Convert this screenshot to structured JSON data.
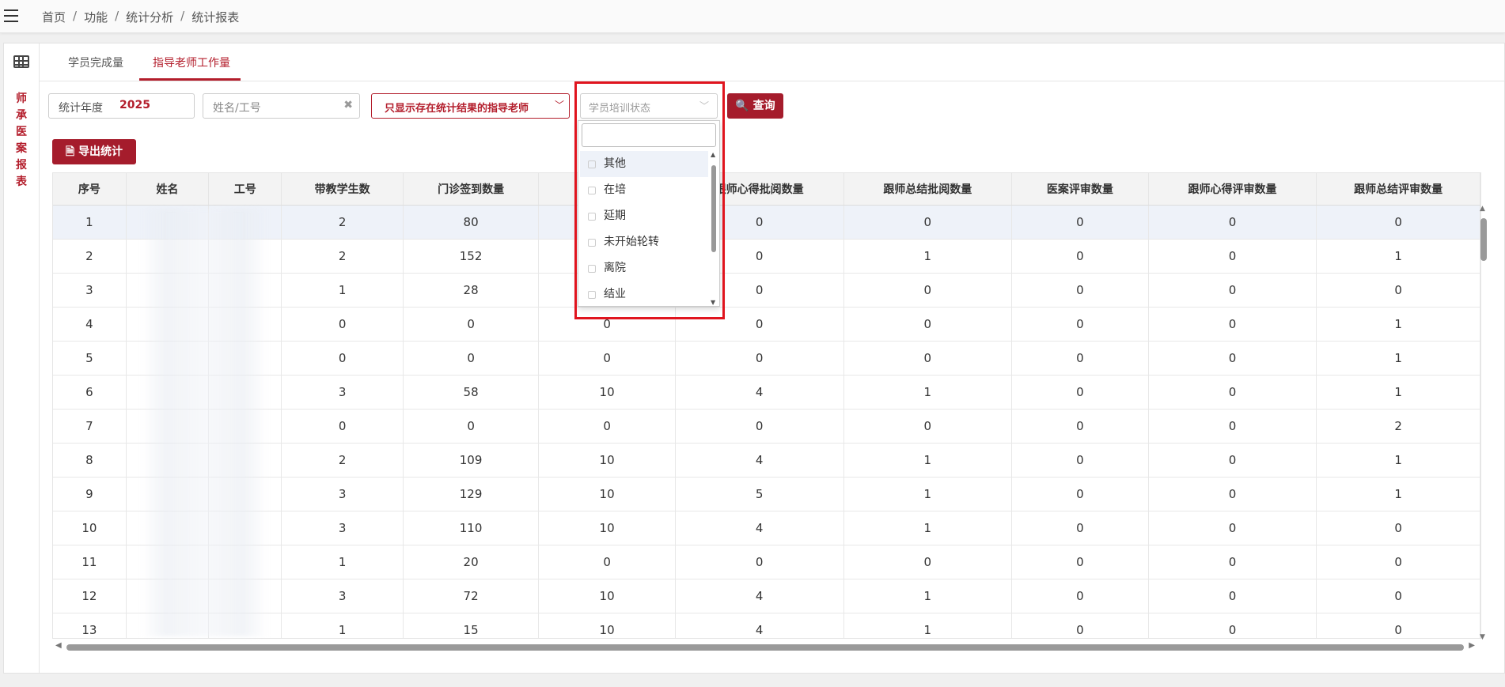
{
  "breadcrumb": [
    "首页",
    "功能",
    "统计分析",
    "统计报表"
  ],
  "side_label": [
    "师",
    "承",
    "医",
    "案",
    "报",
    "表"
  ],
  "tabs": [
    {
      "label": "学员完成量",
      "active": false
    },
    {
      "label": "指导老师工作量",
      "active": true
    }
  ],
  "filters": {
    "year_label": "统计年度",
    "year_value": "2025",
    "name_placeholder": "姓名/工号",
    "clear_icon": "✖",
    "only_with_results": "只显示存在统计结果的指导老师",
    "status_placeholder": "学员培训状态",
    "query_label": "查询",
    "export_label": "导出统计"
  },
  "status_options": [
    "其他",
    "在培",
    "延期",
    "未开始轮转",
    "离院",
    "结业"
  ],
  "table": {
    "headers": [
      "序号",
      "姓名",
      "工号",
      "带教学生数",
      "门诊签到数量",
      "",
      "跟师心得批阅数量",
      "跟师总结批阅数量",
      "医案评审数量",
      "跟师心得评审数量",
      "跟师总结评审数量"
    ],
    "rows": [
      [
        "1",
        "",
        "",
        "2",
        "80",
        "",
        "0",
        "0",
        "0",
        "0",
        "0"
      ],
      [
        "2",
        "",
        "",
        "2",
        "152",
        "",
        "0",
        "1",
        "0",
        "0",
        "1"
      ],
      [
        "3",
        "",
        "",
        "1",
        "28",
        "",
        "0",
        "0",
        "0",
        "0",
        "0"
      ],
      [
        "4",
        "",
        "",
        "0",
        "0",
        "0",
        "0",
        "0",
        "0",
        "0",
        "1"
      ],
      [
        "5",
        "",
        "",
        "0",
        "0",
        "0",
        "0",
        "0",
        "0",
        "0",
        "1"
      ],
      [
        "6",
        "",
        "",
        "3",
        "58",
        "10",
        "4",
        "1",
        "0",
        "0",
        "1"
      ],
      [
        "7",
        "",
        "",
        "0",
        "0",
        "0",
        "0",
        "0",
        "0",
        "0",
        "2"
      ],
      [
        "8",
        "",
        "",
        "2",
        "109",
        "10",
        "4",
        "1",
        "0",
        "0",
        "1"
      ],
      [
        "9",
        "",
        "",
        "3",
        "129",
        "10",
        "5",
        "1",
        "0",
        "0",
        "1"
      ],
      [
        "10",
        "",
        "",
        "3",
        "110",
        "10",
        "4",
        "1",
        "0",
        "0",
        "0"
      ],
      [
        "11",
        "",
        "",
        "1",
        "20",
        "0",
        "0",
        "0",
        "0",
        "0",
        "0"
      ],
      [
        "12",
        "",
        "",
        "3",
        "72",
        "10",
        "4",
        "1",
        "0",
        "0",
        "0"
      ],
      [
        "13",
        "",
        "",
        "1",
        "15",
        "10",
        "4",
        "1",
        "0",
        "0",
        "0"
      ]
    ]
  },
  "icons": {
    "menu": "hamburger-icon",
    "grid": "table-grid-icon",
    "search": "search-icon",
    "export": "file-export-icon"
  },
  "colors": {
    "accent": "#a51c2c",
    "highlight": "#e0141e"
  }
}
